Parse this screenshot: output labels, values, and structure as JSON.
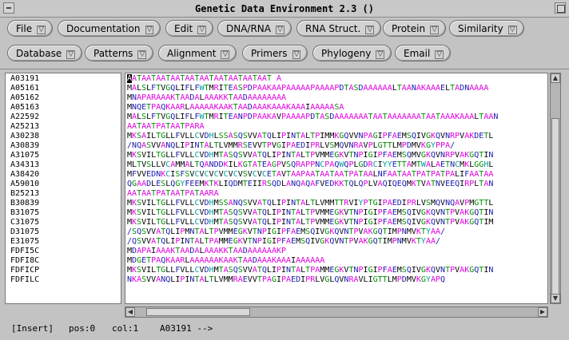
{
  "window": {
    "title": "Genetic Data Environment 2.3 ()"
  },
  "menus": {
    "row1": [
      {
        "label": "File"
      },
      {
        "label": "Documentation"
      },
      {
        "label": "Edit"
      },
      {
        "label": "DNA/RNA"
      },
      {
        "label": "RNA Struct."
      },
      {
        "label": "Protein"
      },
      {
        "label": "Similarity"
      }
    ],
    "row2": [
      {
        "label": "Database"
      },
      {
        "label": "Patterns"
      },
      {
        "label": "Alignment"
      },
      {
        "label": "Primers"
      },
      {
        "label": "Phylogeny"
      },
      {
        "label": "Email"
      }
    ]
  },
  "sequences": [
    {
      "name": "A03191",
      "seq": "AATAATAATAATAATAATAATAATAATAAT A"
    },
    {
      "name": "A05161",
      "seq": "MALSLFTVGQLIFLFWTMRITEASPDPAAKAAPAAAAAPAAAAPDTASDAAAAAALTAANAKAAAELTADNAAAA"
    },
    {
      "name": "A05162",
      "seq": "MNAPARAAAKTAADALAAAKKTAADAAAAAAAA"
    },
    {
      "name": "A05163",
      "seq": "MNQETPAQKAARLAAAAAKAAKTAADAAAKAAAKAAAIAAAAASA"
    },
    {
      "name": "A22592",
      "seq": "MALSLFTVGQLIFLFWTMRITEANPDPAAKAVPAAAAPDTASDAAAAAAATAATAAAAAAATAATAAAKAAALTAAN"
    },
    {
      "name": "A25213",
      "seq": "AATAATPATAATPARA"
    },
    {
      "name": "A30238",
      "seq": "MKSAILTGLLFVLLCVDHLSSASQSVVATQLIPINTALTPIMMKGQVVNPAGIPFAEMSQIVGKQVNRPVAKDETL"
    },
    {
      "name": "A30839",
      "seq": "/NQASVVANQLIPINTALTLVMMRSEVVTPVGIPAEDIPRLVSMQVNRAVPLGTTLMPDMVKGYPPA/"
    },
    {
      "name": "A31075",
      "seq": "MKSVILTGLLFVLLCVDHMTASQSVVATQLIPINTALTPVMMEGKVTNPIGIPFAEMSQMVGKQVNRPVAKGQTIN"
    },
    {
      "name": "A34313",
      "seq": "MLTVSLLVCAMMALTQANDDKILKGTATEAGPVSQRAPPNCPAQWQPLGDRCIYYETTAMTWALAETNCMKLGGHL"
    },
    {
      "name": "A38420",
      "seq": "MFVVEDNKCISFSVCVCVCVCVCVSVCVCETAVTAAPAATAATAATPATAALNFAATAATPATPATPALIFAATAA"
    },
    {
      "name": "A59010",
      "seq": "QGAADLESLQGYFEEMKTKLIQDMTEIIRSQDLANQAQAFVEDKKTQLQPLVAQIQEQMKTVATNVEEQIRPLTAN"
    },
    {
      "name": "B25213",
      "seq": "AATAATPATAATPATAARA"
    },
    {
      "name": "B30839",
      "seq": "MKSVILTGLLFVLLCVDHMSSANQSVVATQLIPINTALTLVMMTTRVIYPTGIPAEDIPRLVSMQVNQAVPMGTTL"
    },
    {
      "name": "B31075",
      "seq": "MKSVILTGLLFVLLCVDHMTASQSVVATQLIPINTALTPVMMEGKVTNPIGIPFAEMSQIVGKQVNTPVAKGQTIN"
    },
    {
      "name": "C31075",
      "seq": "MKSVILTGLLFVLLCVDHMTASQSVVATQLIPINTALTPVMMEGKVTNPIGIPFAEMSQIVGKQVNTPVAKGQTIM"
    },
    {
      "name": "D31075",
      "seq": "/SQSVVATQLIPMNTALTPVMMEGKVTNPIGIPFAEMSQIVGKQVNTPVAKGQTIMPNMVKTYAA/"
    },
    {
      "name": "E31075",
      "seq": "/QSVVATQLIPINTALTPAMMEGKVTNPIGIPFAEMSQIVGKQVNTPVAKGQTIMPNMVKTYAA/"
    },
    {
      "name": "FDFI5C",
      "seq": "MDAPAIAAAKTAADALAAAKKTAADAAAAAAKP"
    },
    {
      "name": "FDFI8C",
      "seq": "MDGETPAQKAARLAAAAAAKAAKTAADAAAKAAAIAAAAAA"
    },
    {
      "name": "FDFICP",
      "seq": "MKSVILTGLLFVLLCVDHMTASQSVVATQLIPINTALTPAMMEGKVTNPIGIPFAEMSQIVGKQVNTPVAKGQTIN"
    },
    {
      "name": "FDFILC",
      "seq": "NKASVVANQLIPINTALTLVMMRAEVVTPAGIPAEDIPRLVGLQVNRAVLIGTTLMPDMVKGYAPQ"
    }
  ],
  "status": {
    "mode": "[Insert]",
    "position": "pos:0",
    "column": "col:1",
    "current": "A03191 -->"
  },
  "colors": {
    "A": "#e000e0",
    "C": "#00a0a0",
    "D": "#1a1ab0",
    "E": "#1a1ab0",
    "F": "#1a1ab0",
    "G": "#009000",
    "H": "#00a0a0",
    "I": "#000000",
    "K": "#e000e0",
    "L": "#000000",
    "M": "#000000",
    "N": "#1a1ab0",
    "P": "#e000e0",
    "Q": "#1a1ab0",
    "R": "#e000e0",
    "S": "#009000",
    "T": "#009000",
    "V": "#000000",
    "W": "#00a0a0",
    "Y": "#00a0a0",
    "/": "#1a1ab0",
    "default": "#000000"
  }
}
